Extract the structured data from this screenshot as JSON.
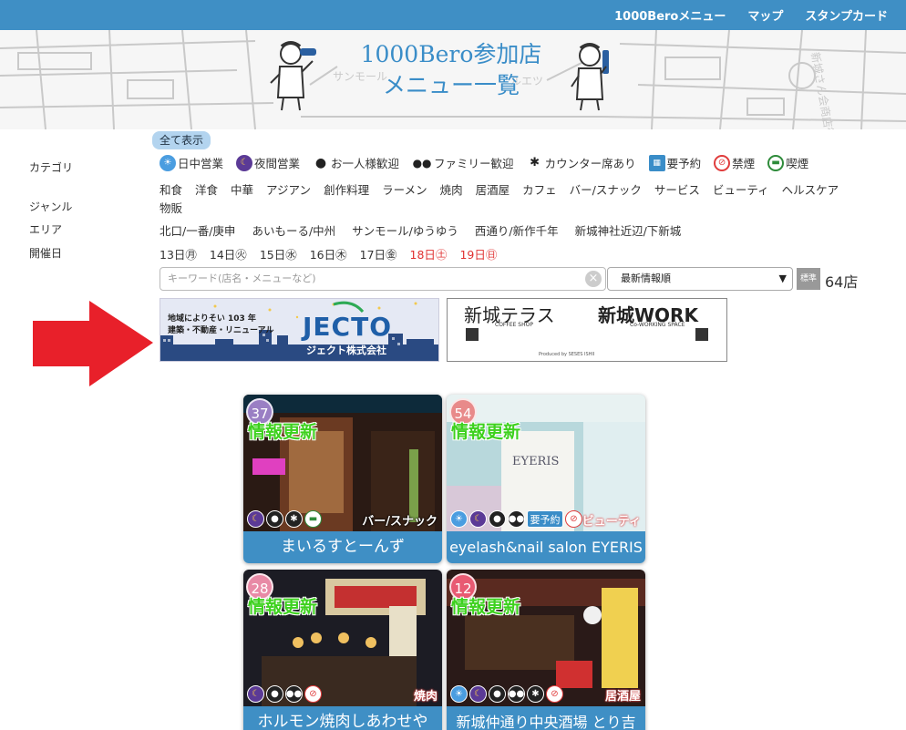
{
  "nav": {
    "items": [
      "1000Beroメニュー",
      "マップ",
      "スタンプカード"
    ]
  },
  "banner": {
    "title_line1": "1000Bero参加店",
    "title_line2": "メニュー一覧"
  },
  "filters": {
    "show_all": "全て表示",
    "labels": {
      "category": "カテゴリ",
      "genre": "ジャンル",
      "area": "エリア",
      "date": "開催日"
    },
    "categories": [
      {
        "label": "日中営業",
        "icon": "sun-icon",
        "color": "#4a9de0"
      },
      {
        "label": "夜間営業",
        "icon": "moon-icon",
        "color": "#5b3a96"
      },
      {
        "label": "お一人様歓迎",
        "icon": "person-icon",
        "color": "#222222"
      },
      {
        "label": "ファミリー歓迎",
        "icon": "family-icon",
        "color": "#222222"
      },
      {
        "label": "カウンター席あり",
        "icon": "counter-icon",
        "color": "#222222"
      },
      {
        "label": "要予約",
        "icon": "reservation-icon",
        "color": "#3a8dc8"
      },
      {
        "label": "禁煙",
        "icon": "no-smoking-icon",
        "color": "#e03c3c"
      },
      {
        "label": "喫煙",
        "icon": "smoking-icon",
        "color": "#2e8b3a"
      }
    ],
    "genres_row1": [
      "和食",
      "洋食",
      "中華",
      "アジアン",
      "創作料理",
      "ラーメン",
      "焼肉",
      "居酒屋",
      "カフェ",
      "バー/スナック",
      "サービス",
      "ビューティ",
      "ヘルスケア"
    ],
    "genres_row2": [
      "物販"
    ],
    "areas": [
      "北口/一番/庚申",
      "あいもーる/中州",
      "サンモール/ゆうゆう",
      "西通り/新作千年",
      "新城神社近辺/下新城"
    ],
    "dates": [
      {
        "label": "13日㊊",
        "red": false
      },
      {
        "label": "14日㊋",
        "red": false
      },
      {
        "label": "15日㊌",
        "red": false
      },
      {
        "label": "16日㊍",
        "red": false
      },
      {
        "label": "17日㊎",
        "red": false
      },
      {
        "label": "18日㊏",
        "red": true
      },
      {
        "label": "19日㊐",
        "red": true
      }
    ]
  },
  "search": {
    "placeholder": "キーワード(店名・メニューなど)",
    "sort_value": "最新情報順",
    "view_icon": "標準",
    "count": "64店"
  },
  "ads": {
    "jecto": {
      "tagline1": "地域によりそい 103 年",
      "tagline2": "建築・不動産・リニューアル",
      "logo": "JECTO",
      "company": "ジェクト株式会社"
    },
    "shinjo": {
      "terrace": "新城テラス",
      "terrace_sub": "COFFEE SHOP",
      "work": "新城WORK",
      "work_sub": "Co-WORKING SPACE",
      "credit": "Produced by SESES ISHII"
    }
  },
  "cards": [
    {
      "num": "37",
      "num_color": "#9a7fc4",
      "update": "情報更新",
      "name": "まいるすとーんず",
      "genre": "バー/スナック",
      "icons": [
        "moon-icon",
        "person-icon",
        "counter-icon",
        "smoking-icon"
      ]
    },
    {
      "num": "54",
      "num_color": "#e88a8a",
      "update": "情報更新",
      "name": "eyelash&nail salon EYERIS",
      "genre": "ビューティ",
      "icons": [
        "sun-icon",
        "moon-icon",
        "person-icon",
        "family-icon",
        "reservation-icon",
        "no-smoking-icon"
      ]
    },
    {
      "num": "28",
      "num_color": "#e88aa6",
      "update": "情報更新",
      "name": "ホルモン焼肉しあわせや",
      "genre": "焼肉",
      "icons": [
        "moon-icon",
        "person-icon",
        "family-icon",
        "no-smoking-icon"
      ]
    },
    {
      "num": "12",
      "num_color": "#e85a72",
      "update": "情報更新",
      "name": "新城仲通り中央酒場 とり吉",
      "genre": "居酒屋",
      "icons": [
        "sun-icon",
        "moon-icon",
        "person-icon",
        "family-icon",
        "counter-icon",
        "no-smoking-icon"
      ]
    }
  ],
  "icon_labels": {
    "reservation": "要予約"
  }
}
